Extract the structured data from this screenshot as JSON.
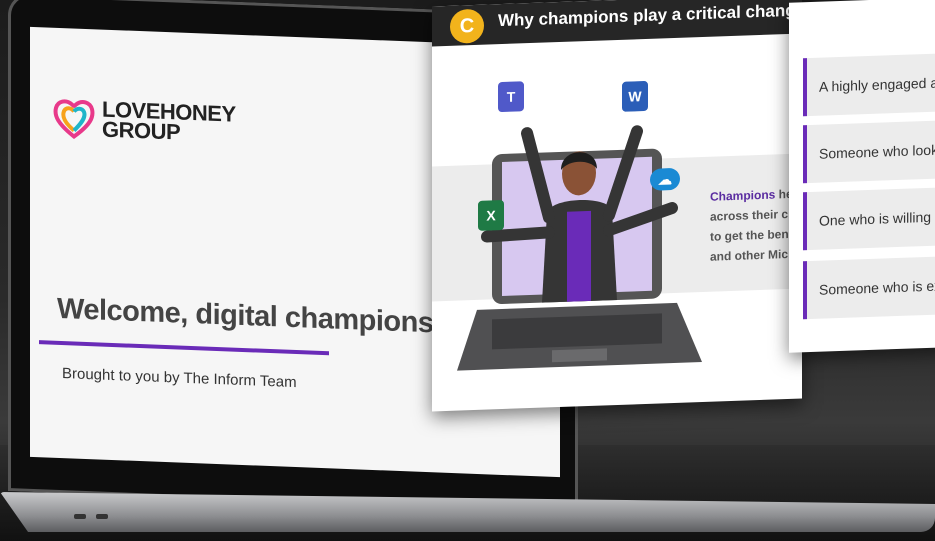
{
  "laptop_slide": {
    "logo_line1": "LOVEHONEY",
    "logo_line2": "GROUP",
    "title": "Welcome, digital champions!",
    "byline": "Brought to you by The Inform Team",
    "accent_color": "#6a2bb8"
  },
  "slide2": {
    "badge": "C",
    "title": "Why champions play a critical change rol",
    "text_highlight": "Champions",
    "text_line1": " he",
    "text_line2": "across their c",
    "text_line3": "to get the ben",
    "text_line4": "and other Mic",
    "app_icons": [
      "teams-icon",
      "word-icon",
      "excel-icon",
      "onedrive-icon"
    ]
  },
  "slide3": {
    "items": [
      "A highly engaged an",
      "Someone who looks",
      "One who is willing t",
      "Someone who is ex"
    ]
  }
}
